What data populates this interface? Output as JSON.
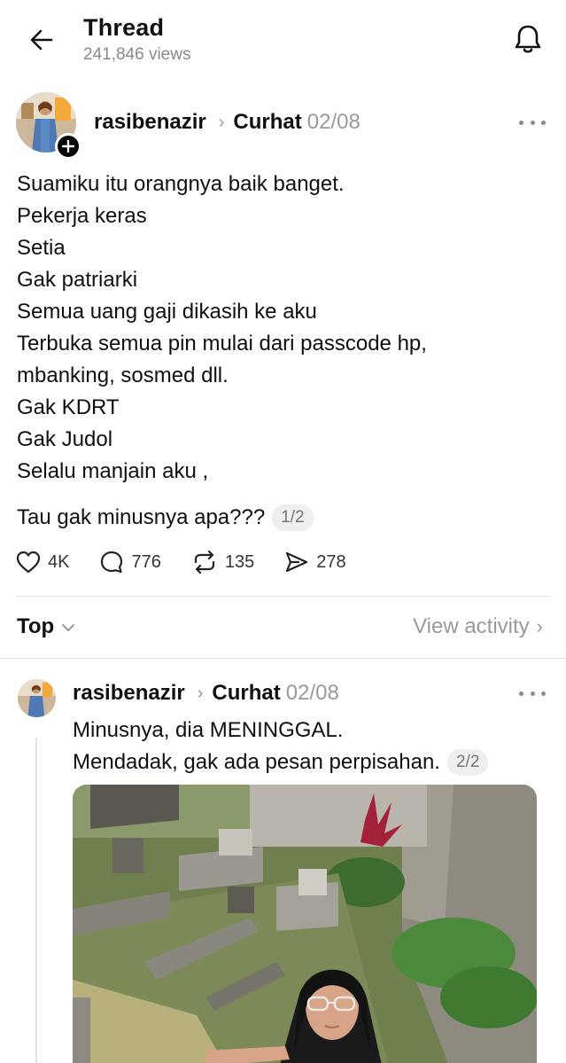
{
  "header": {
    "title": "Thread",
    "views": "241,846 views"
  },
  "post": {
    "username": "rasibenazir",
    "community": "Curhat",
    "date": "02/08",
    "lines": [
      "Suamiku itu orangnya baik banget.",
      "Pekerja keras",
      "Setia",
      "Gak patriarki",
      "Semua uang gaji dikasih ke aku",
      "Terbuka semua pin mulai dari passcode hp,",
      "mbanking, sosmed dll.",
      "Gak KDRT",
      "Gak Judol",
      "Selalu manjain aku ,"
    ],
    "last_line": "Tau gak minusnya apa???",
    "page_badge": "1/2",
    "likes": "4K",
    "comments": "776",
    "reposts": "135",
    "shares": "278"
  },
  "sort": {
    "label": "Top",
    "view_activity": "View activity"
  },
  "reply": {
    "username": "rasibenazir",
    "community": "Curhat",
    "date": "02/08",
    "line1": "Minusnya, dia MENINGGAL.",
    "line2": "Mendadak, gak ada pesan perpisahan.",
    "page_badge": "2/2"
  },
  "icons": {
    "back": "arrow-left-icon",
    "bell": "bell-icon",
    "heart": "heart-icon",
    "comment": "comment-bubble-icon",
    "repost": "repost-icon",
    "share": "send-icon"
  }
}
